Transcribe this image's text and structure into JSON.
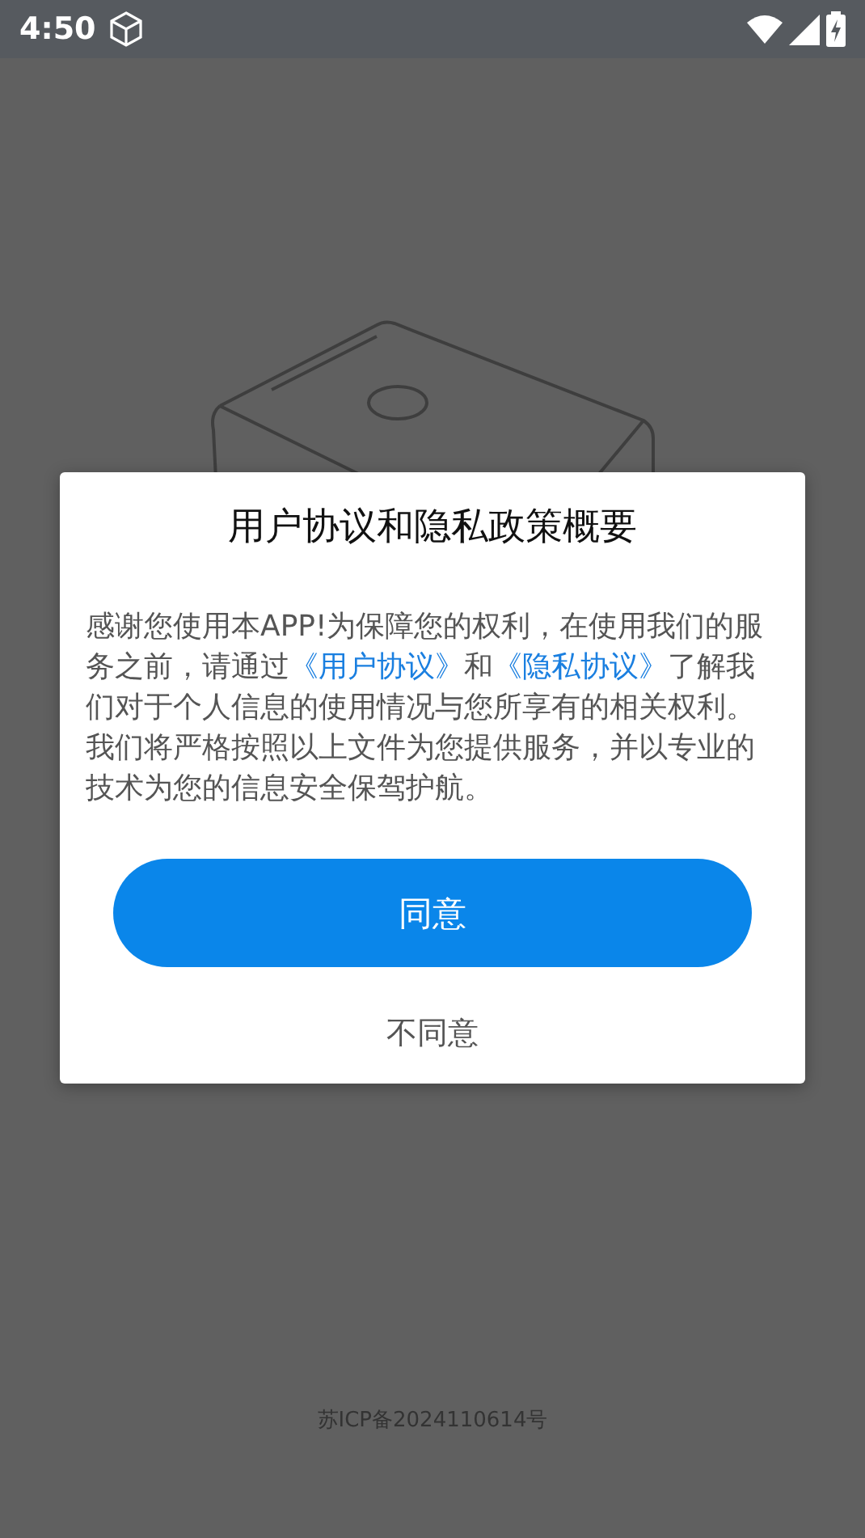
{
  "status_bar": {
    "time": "4:50"
  },
  "dialog": {
    "title": "用户协议和隐私政策概要",
    "body": [
      {
        "kind": "text",
        "text": "感谢您使用本APP!为保障您的权利，在使用我们的服务之前，请通过"
      },
      {
        "kind": "link",
        "text": "《用户协议》"
      },
      {
        "kind": "text",
        "text": "和"
      },
      {
        "kind": "link",
        "text": "《隐私协议》"
      },
      {
        "kind": "text",
        "text": "了解我们对于个人信息的使用情况与您所享有的相关权利。我们将严格按照以上文件为您提供服务，并以专业的技术为您的信息安全保驾护航。"
      }
    ],
    "agree_button": "同意",
    "decline_button": "不同意"
  },
  "footer": {
    "icp": "苏ICP备2024110614号"
  }
}
